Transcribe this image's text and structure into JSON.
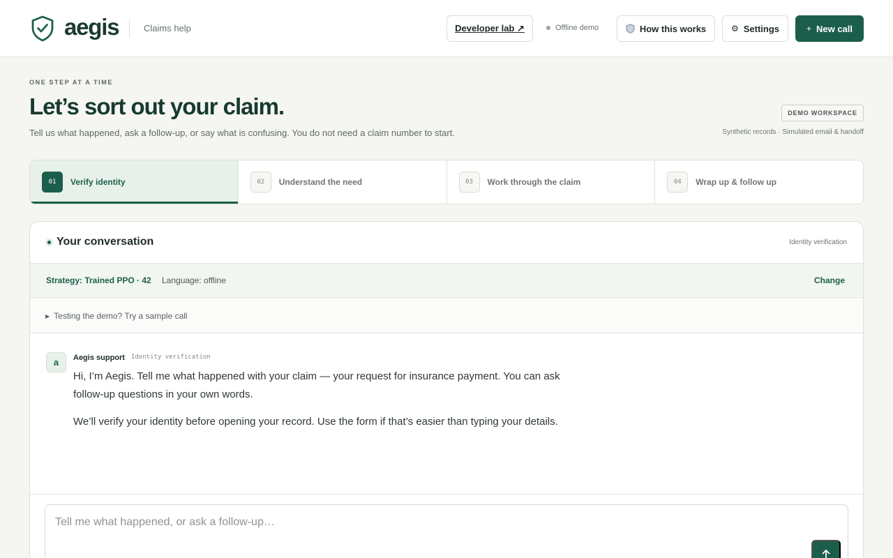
{
  "brand": {
    "name": "aegis",
    "subtitle": "Claims help"
  },
  "header": {
    "developer_lab": "Developer lab ↗",
    "offline_status": "Offline demo",
    "how_it_works": "How this works",
    "how_icon": "shield-icon",
    "settings": "Settings",
    "settings_icon": "gear-icon",
    "new_call": "New call",
    "new_call_icon": "plus-icon"
  },
  "hero": {
    "eyebrow": "ONE STEP AT A TIME",
    "title": "Let’s sort out your claim.",
    "subtitle": "Tell us what happened, ask a follow-up, or say what is confusing. You do not need a claim number to start.",
    "badge": "DEMO WORKSPACE",
    "note": "Synthetic records · Simulated email & handoff"
  },
  "steps": [
    {
      "num": "01",
      "label": "Verify identity",
      "active": true
    },
    {
      "num": "02",
      "label": "Understand the need",
      "active": false
    },
    {
      "num": "03",
      "label": "Work through the claim",
      "active": false
    },
    {
      "num": "04",
      "label": "Wrap up & follow up",
      "active": false
    }
  ],
  "conversation": {
    "title": "Your conversation",
    "tag": "Identity verification",
    "strategy": "Strategy: Trained PPO · 42",
    "language": "Language: offline",
    "change": "Change",
    "sample": "Testing the demo? Try a sample call",
    "messages": [
      {
        "avatar": "a",
        "sender": "Aegis support",
        "tag": "Identity verification",
        "paragraphs": [
          "Hi, I’m Aegis. Tell me what happened with your claim — your request for insurance payment. You can ask follow-up questions in your own words.",
          "We’ll verify your identity before opening your record. Use the form if that’s easier than typing your details."
        ]
      }
    ],
    "composer_placeholder": "Tell me what happened, or ask a follow-up…"
  },
  "colors": {
    "accent": "#1c5e4c",
    "accent_soft": "#e7f1ea",
    "background": "#f5f6f2"
  }
}
